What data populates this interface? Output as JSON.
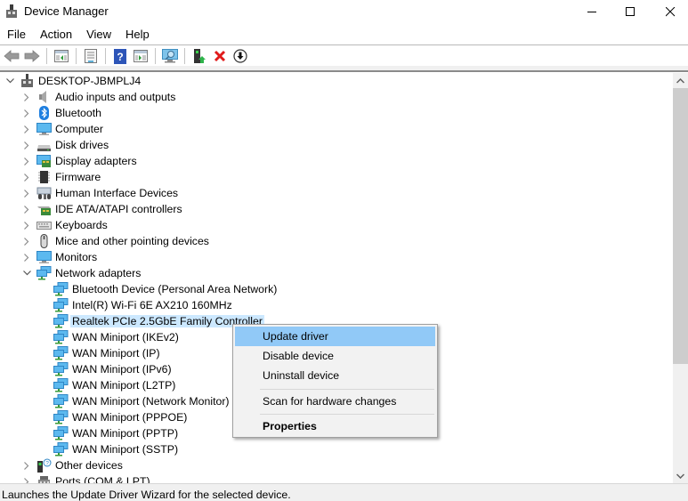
{
  "window": {
    "title": "Device Manager",
    "controls": {
      "minimize": "minimize",
      "maximize": "maximize",
      "close": "close"
    }
  },
  "menubar": [
    "File",
    "Action",
    "View",
    "Help"
  ],
  "toolbar": {
    "buttons": [
      {
        "name": "back",
        "icon": "back-arrow-icon"
      },
      {
        "name": "forward",
        "icon": "forward-arrow-icon"
      },
      {
        "name": "show-hide-console-tree",
        "icon": "console-tree-icon"
      },
      {
        "name": "properties",
        "icon": "properties-sheet-icon"
      },
      {
        "name": "help",
        "icon": "help-icon"
      },
      {
        "name": "show-hide-action-pane",
        "icon": "action-pane-icon"
      },
      {
        "name": "scan-hardware",
        "icon": "scan-monitor-icon"
      },
      {
        "name": "update-driver",
        "icon": "update-driver-icon"
      },
      {
        "name": "uninstall-device",
        "icon": "red-x-icon"
      },
      {
        "name": "disable-device",
        "icon": "down-arrow-circle-icon"
      }
    ]
  },
  "tree": {
    "root": "DESKTOP-JBMPLJ4",
    "categories": [
      {
        "label": "Audio inputs and outputs",
        "icon": "speaker-icon",
        "expanded": false
      },
      {
        "label": "Bluetooth",
        "icon": "bluetooth-icon",
        "expanded": false
      },
      {
        "label": "Computer",
        "icon": "computer-icon",
        "expanded": false
      },
      {
        "label": "Disk drives",
        "icon": "disk-drive-icon",
        "expanded": false
      },
      {
        "label": "Display adapters",
        "icon": "display-adapter-icon",
        "expanded": false
      },
      {
        "label": "Firmware",
        "icon": "chip-icon",
        "expanded": false
      },
      {
        "label": "Human Interface Devices",
        "icon": "hid-icon",
        "expanded": false
      },
      {
        "label": "IDE ATA/ATAPI controllers",
        "icon": "controller-card-icon",
        "expanded": false
      },
      {
        "label": "Keyboards",
        "icon": "keyboard-icon",
        "expanded": false
      },
      {
        "label": "Mice and other pointing devices",
        "icon": "mouse-icon",
        "expanded": false
      },
      {
        "label": "Monitors",
        "icon": "monitor-icon",
        "expanded": false
      },
      {
        "label": "Network adapters",
        "icon": "network-icon",
        "expanded": true
      }
    ],
    "network_adapters": [
      "Bluetooth Device (Personal Area Network)",
      "Intel(R) Wi-Fi 6E AX210 160MHz",
      "Realtek PCIe 2.5GbE Family Controller",
      "WAN Miniport (IKEv2)",
      "WAN Miniport (IP)",
      "WAN Miniport (IPv6)",
      "WAN Miniport (L2TP)",
      "WAN Miniport (Network Monitor)",
      "WAN Miniport (PPPOE)",
      "WAN Miniport (PPTP)",
      "WAN Miniport (SSTP)"
    ],
    "selected": "Realtek PCIe 2.5GbE Family Controller",
    "after": [
      {
        "label": "Other devices",
        "icon": "unknown-device-icon",
        "expanded": false
      },
      {
        "label": "Ports (COM & LPT)",
        "icon": "port-icon",
        "expanded": false
      }
    ]
  },
  "context_menu": {
    "items": [
      {
        "label": "Update driver",
        "highlighted": true
      },
      {
        "label": "Disable device"
      },
      {
        "label": "Uninstall device"
      },
      {
        "label": "Scan for hardware changes"
      },
      {
        "label": "Properties",
        "bold": true
      }
    ]
  },
  "statusbar": {
    "text": "Launches the Update Driver Wizard for the selected device."
  },
  "colors": {
    "selection": "#cce8ff",
    "menu_highlight": "#91c9f7",
    "menu_bg": "#f2f2f2",
    "statusbar_bg": "#f0f0f0"
  }
}
